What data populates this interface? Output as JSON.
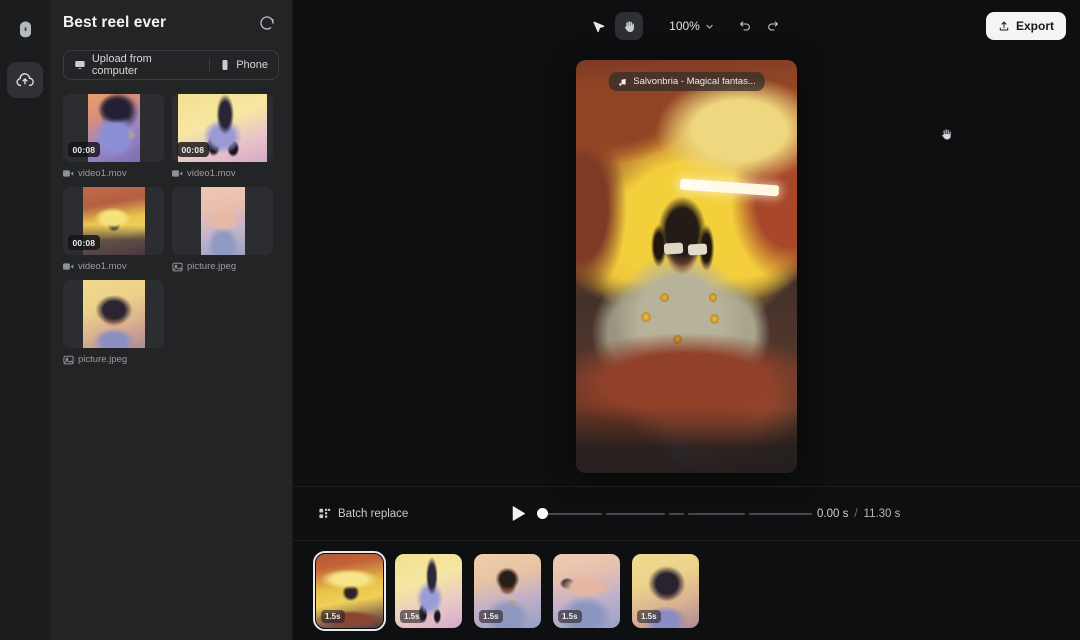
{
  "rail": {
    "logo_icon": "app-logo-icon",
    "items": [
      {
        "icon": "cloud-upload-icon",
        "name": "media-upload",
        "active": true
      }
    ]
  },
  "panel": {
    "title": "Best reel ever",
    "spinner_icon": "loading-spinner-icon",
    "upload": {
      "computer_label": "Upload from computer",
      "computer_icon": "monitor-icon",
      "phone_label": "Phone",
      "phone_icon": "phone-icon"
    },
    "media": [
      {
        "name": "video1.mov",
        "duration": "00:08",
        "type": "video",
        "icon": "video-file-icon"
      },
      {
        "name": "video1.mov",
        "duration": "00:08",
        "type": "video",
        "icon": "video-file-icon"
      },
      {
        "name": "video1.mov",
        "duration": "00:08",
        "type": "video",
        "icon": "video-file-icon"
      },
      {
        "name": "picture.jpeg",
        "duration": "",
        "type": "image",
        "icon": "image-file-icon"
      },
      {
        "name": "picture.jpeg",
        "duration": "",
        "type": "image",
        "icon": "image-file-icon"
      }
    ]
  },
  "toolbar": {
    "select_tool_icon": "cursor-arrow-icon",
    "hand_tool_icon": "hand-icon",
    "zoom_level": "100%",
    "zoom_chevron_icon": "chevron-down-icon",
    "undo_icon": "undo-icon",
    "redo_icon": "redo-icon",
    "export_label": "Export",
    "export_icon": "upload-icon"
  },
  "preview": {
    "music_icon": "music-note-icon",
    "music_label": "Salvonbria - Magical fantas...",
    "cursor_icon": "hand-cursor-icon"
  },
  "transport": {
    "batch_replace_label": "Batch replace",
    "batch_replace_icon": "batch-replace-icon",
    "play_icon": "play-icon",
    "current_time": "0.00 s",
    "time_separator": "/",
    "total_time": "11.30 s"
  },
  "timeline": {
    "clips": [
      {
        "duration": "1.5s",
        "selected": true
      },
      {
        "duration": "1.5s",
        "selected": false
      },
      {
        "duration": "1.5s",
        "selected": false
      },
      {
        "duration": "1.5s",
        "selected": false
      },
      {
        "duration": "1.5s",
        "selected": false
      }
    ]
  },
  "colors": {
    "rail_bg": "#1b1c1e",
    "panel_bg": "#232426",
    "canvas_bg": "#0e0f10",
    "export_bg": "#f3f4f5",
    "accent_text": "#f2f3f4"
  }
}
